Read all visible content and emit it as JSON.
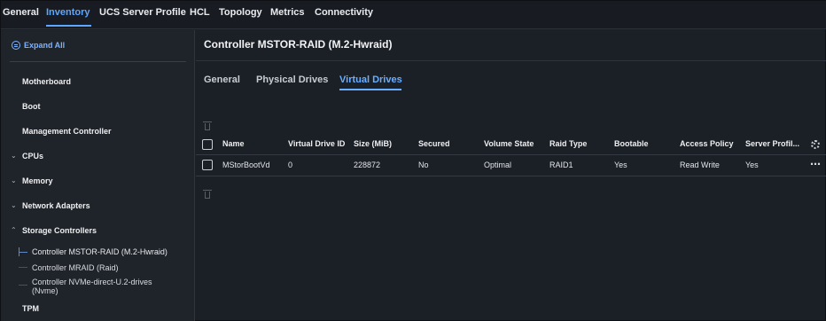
{
  "top_tabs": [
    "General",
    "Inventory",
    "UCS Server Profile",
    "HCL",
    "Topology",
    "Metrics",
    "Connectivity"
  ],
  "active_top_tab": "Inventory",
  "sidebar": {
    "expand_all": "Expand All",
    "items": [
      "Motherboard",
      "Boot",
      "Management Controller",
      "CPUs",
      "Memory",
      "Network Adapters",
      "Storage Controllers",
      "TPM"
    ],
    "storage_controllers": [
      "Controller MSTOR-RAID (M.2-Hwraid)",
      "Controller MRAID (Raid)",
      "Controller NVMe-direct-U.2-drives",
      "(Nvme)"
    ]
  },
  "main": {
    "title": "Controller MSTOR-RAID (M.2-Hwraid)",
    "tabs": [
      "General",
      "Physical Drives",
      "Virtual Drives"
    ],
    "active_tab": "Virtual Drives"
  },
  "table": {
    "columns": [
      "Name",
      "Virtual Drive ID",
      "Size (MiB)",
      "Secured",
      "Volume State",
      "Raid Type",
      "Bootable",
      "Access Policy",
      "Server Profil..."
    ],
    "rows": [
      [
        "MStorBootVd",
        "0",
        "228872",
        "No",
        "Optimal",
        "RAID1",
        "Yes",
        "Read Write",
        "Yes"
      ]
    ]
  },
  "colors": {
    "accent": "#5ea7ff",
    "background": "#1b1f26",
    "sidebar": "#1f232a"
  },
  "icons": [
    "expand-all-icon",
    "chevron-down-icon",
    "chevron-up-icon",
    "trash-icon",
    "settings-gear-icon",
    "more-options-icon"
  ]
}
